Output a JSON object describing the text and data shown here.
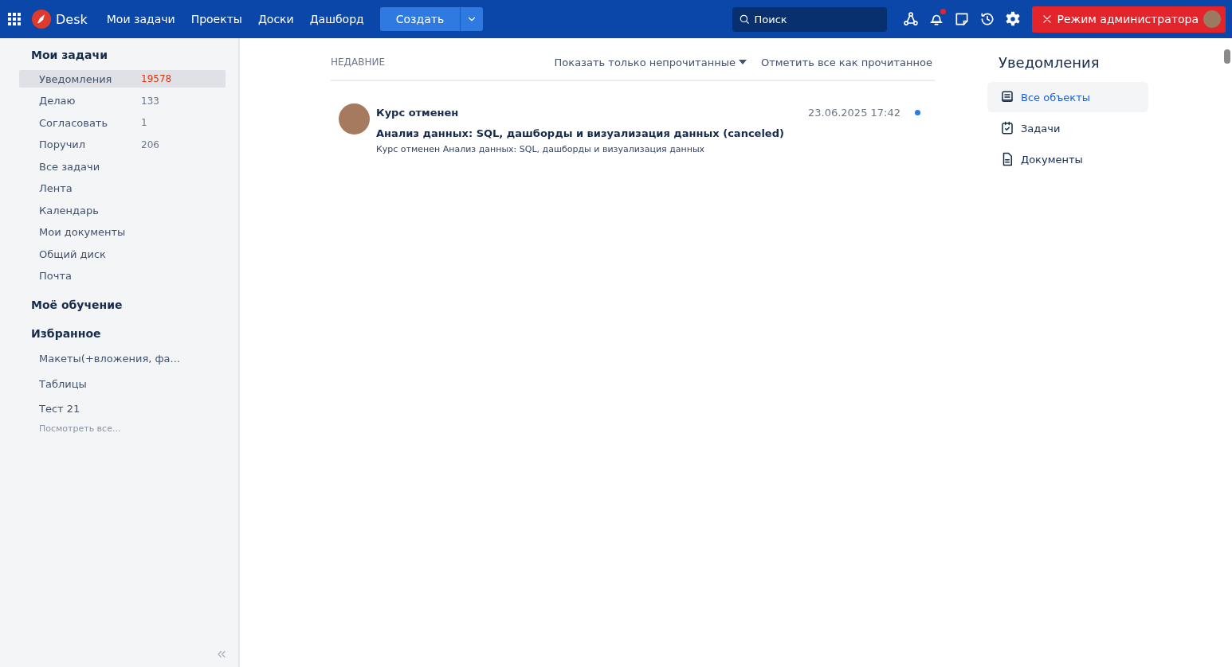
{
  "topbar": {
    "logo": "Desk",
    "nav": [
      {
        "label": "Мои задачи"
      },
      {
        "label": "Проекты"
      },
      {
        "label": "Доски"
      },
      {
        "label": "Дашборд"
      }
    ],
    "create_button": "Создать",
    "search": {
      "placeholder": "Поиск"
    },
    "bell_badge": true,
    "admin_button": "Режим администратора"
  },
  "sidebar": {
    "sections": [
      {
        "title": "Мои задачи",
        "items": [
          {
            "label": "Уведомления",
            "count": "19578",
            "selected": true
          },
          {
            "label": "Делаю",
            "count": "133",
            "selected": false
          },
          {
            "label": "Согласовать",
            "count": "1",
            "selected": false
          },
          {
            "label": "Поручил",
            "count": "206",
            "selected": false
          },
          {
            "label": "Все задачи",
            "selected": false
          },
          {
            "label": "Лента",
            "selected": false
          },
          {
            "label": "Календарь",
            "selected": false
          },
          {
            "label": "Мои документы",
            "selected": false
          },
          {
            "label": "Общий диск",
            "selected": false
          },
          {
            "label": "Почта",
            "selected": false
          }
        ]
      },
      {
        "title": "Моё обучение"
      },
      {
        "title": "Избранное",
        "items": [
          {
            "label": "Макеты(+вложения, фа...",
            "selected": false
          },
          {
            "label": "Таблицы",
            "selected": false
          },
          {
            "label": "Тест 21",
            "selected": false
          }
        ],
        "more": "Посмотреть все..."
      }
    ]
  },
  "feed": {
    "heading": "НЕДАВНИЕ",
    "filter": "Показать только непрочитанные",
    "mark_all": "Отметить все как прочитанное",
    "notifications": [
      {
        "title": "Курс отменен",
        "date": "23.06.2025 17:42",
        "unread": true,
        "subject": "Анализ данных: SQL, дашборды и визуализация данных (canceled)",
        "body": "Курс отменен Анализ данных: SQL, дашборды и визуализация данных"
      }
    ]
  },
  "filters": {
    "title": "Уведомления",
    "items": [
      {
        "kind": "all",
        "label": "Все объекты",
        "selected": true
      },
      {
        "kind": "tasks",
        "label": "Задачи",
        "selected": false
      },
      {
        "kind": "docs",
        "label": "Документы",
        "selected": false
      }
    ]
  }
}
